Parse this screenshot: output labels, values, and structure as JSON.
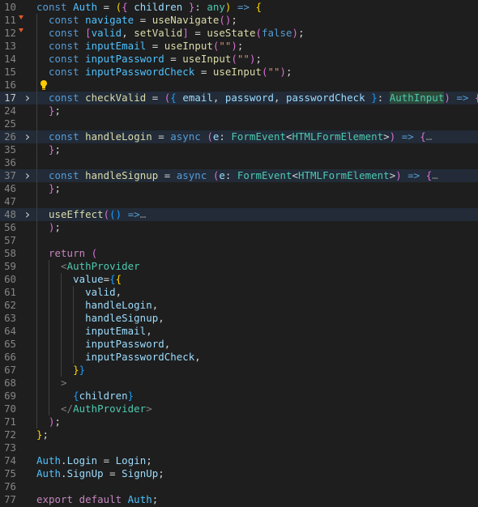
{
  "editor": {
    "lines": [
      {
        "num": "10",
        "code": "<span class='k'>const</span> <span class='cv'>Auth</span> <span class='p'>=</span> <span class='b1'>(</span><span class='b2'>{</span> <span class='v'>children</span> <span class='b2'>}</span><span class='p'>:</span> <span class='t'>any</span><span class='b1'>)</span> <span class='k'>=&gt;</span> <span class='b1'>{</span>"
      },
      {
        "num": "11",
        "mark": true,
        "code": "  <span class='k'>const</span> <span class='cv'>navigate</span> <span class='p'>=</span> <span class='f'>useNavigate</span><span class='b2'>()</span><span class='p'>;</span>"
      },
      {
        "num": "12",
        "mark": true,
        "code": "  <span class='k'>const</span> <span class='b2'>[</span><span class='cv'>valid</span><span class='p'>,</span> <span class='f'>setValid</span><span class='b2'>]</span> <span class='p'>=</span> <span class='f'>useState</span><span class='b2'>(</span><span class='k'>false</span><span class='b2'>)</span><span class='p'>;</span>"
      },
      {
        "num": "13",
        "code": "  <span class='k'>const</span> <span class='cv'>inputEmail</span> <span class='p'>=</span> <span class='f'>useInput</span><span class='b2'>(</span><span class='s'>\"\"</span><span class='b2'>)</span><span class='p'>;</span>"
      },
      {
        "num": "14",
        "code": "  <span class='k'>const</span> <span class='cv'>inputPassword</span> <span class='p'>=</span> <span class='f'>useInput</span><span class='b2'>(</span><span class='s'>\"\"</span><span class='b2'>)</span><span class='p'>;</span>"
      },
      {
        "num": "15",
        "code": "  <span class='k'>const</span> <span class='cv'>inputPasswordCheck</span> <span class='p'>=</span> <span class='f'>useInput</span><span class='b2'>(</span><span class='s'>\"\"</span><span class='b2'>)</span><span class='p'>;</span>"
      },
      {
        "num": "16",
        "bulb": true,
        "code": ""
      },
      {
        "num": "17",
        "active": true,
        "fold": true,
        "hl": true,
        "code": "  <span class='k'>const</span> <span class='f'>checkValid</span> <span class='p'>=</span> <span class='b2'>(</span><span class='b3'>{</span> <span class='v'>email</span><span class='p'>,</span> <span class='v'>password</span><span class='p'>,</span> <span class='v'>passwordCheck</span> <span class='b3'>}</span><span class='p'>:</span> <span class='t sel'>AuthInput</span><span class='b2'>)</span> <span class='k'>=&gt;</span> <span class='b2'>{</span><span class='g'>…</span>"
      },
      {
        "num": "24",
        "code": "  <span class='b2'>}</span><span class='p'>;</span>"
      },
      {
        "num": "25",
        "code": ""
      },
      {
        "num": "26",
        "fold": true,
        "hl": true,
        "code": "  <span class='k'>const</span> <span class='f'>handleLogin</span> <span class='p'>=</span> <span class='k'>async</span> <span class='b2'>(</span><span class='v'>e</span><span class='p'>:</span> <span class='t'>FormEvent</span><span class='p'>&lt;</span><span class='t'>HTMLFormElement</span><span class='p'>&gt;</span><span class='b2'>)</span> <span class='k'>=&gt;</span> <span class='b2'>{</span><span class='g'>…</span>"
      },
      {
        "num": "35",
        "code": "  <span class='b2'>}</span><span class='p'>;</span>"
      },
      {
        "num": "36",
        "code": ""
      },
      {
        "num": "37",
        "fold": true,
        "hl": true,
        "code": "  <span class='k'>const</span> <span class='f'>handleSignup</span> <span class='p'>=</span> <span class='k'>async</span> <span class='b2'>(</span><span class='v'>e</span><span class='p'>:</span> <span class='t'>FormEvent</span><span class='p'>&lt;</span><span class='t'>HTMLFormElement</span><span class='p'>&gt;</span><span class='b2'>)</span> <span class='k'>=&gt;</span> <span class='b2'>{</span><span class='g'>…</span>"
      },
      {
        "num": "46",
        "code": "  <span class='b2'>}</span><span class='p'>;</span>"
      },
      {
        "num": "47",
        "code": ""
      },
      {
        "num": "48",
        "fold": true,
        "hl": true,
        "code": "  <span class='f'>useEffect</span><span class='b2'>(</span><span class='b3'>()</span> <span class='k'>=&gt;</span><span class='g'>…</span>"
      },
      {
        "num": "56",
        "code": "  <span class='b2'>)</span><span class='p'>;</span>"
      },
      {
        "num": "57",
        "code": ""
      },
      {
        "num": "58",
        "code": "  <span class='c'>return</span> <span class='b2'>(</span>"
      },
      {
        "num": "59",
        "code": "    <span class='g'>&lt;</span><span class='t'>AuthProvider</span>"
      },
      {
        "num": "60",
        "code": "      <span class='v'>value</span><span class='p'>=</span><span class='b3'>{</span><span class='b1'>{</span>"
      },
      {
        "num": "61",
        "code": "        <span class='v'>valid</span><span class='p'>,</span>"
      },
      {
        "num": "62",
        "code": "        <span class='v'>handleLogin</span><span class='p'>,</span>"
      },
      {
        "num": "63",
        "code": "        <span class='v'>handleSignup</span><span class='p'>,</span>"
      },
      {
        "num": "64",
        "code": "        <span class='v'>inputEmail</span><span class='p'>,</span>"
      },
      {
        "num": "65",
        "code": "        <span class='v'>inputPassword</span><span class='p'>,</span>"
      },
      {
        "num": "66",
        "code": "        <span class='v'>inputPasswordCheck</span><span class='p'>,</span>"
      },
      {
        "num": "67",
        "code": "      <span class='b1'>}</span><span class='b3'>}</span>"
      },
      {
        "num": "68",
        "code": "    <span class='g'>&gt;</span>"
      },
      {
        "num": "69",
        "code": "      <span class='b3'>{</span><span class='v'>children</span><span class='b3'>}</span>"
      },
      {
        "num": "70",
        "code": "    <span class='g'>&lt;/</span><span class='t'>AuthProvider</span><span class='g'>&gt;</span>"
      },
      {
        "num": "71",
        "code": "  <span class='b2'>)</span><span class='p'>;</span>"
      },
      {
        "num": "72",
        "code": "<span class='b1'>}</span><span class='p'>;</span>"
      },
      {
        "num": "73",
        "code": ""
      },
      {
        "num": "74",
        "code": "<span class='cv'>Auth</span><span class='p'>.</span><span class='v'>Login</span> <span class='p'>=</span> <span class='v'>Login</span><span class='p'>;</span>"
      },
      {
        "num": "75",
        "code": "<span class='cv'>Auth</span><span class='p'>.</span><span class='v'>SignUp</span> <span class='p'>=</span> <span class='v'>SignUp</span><span class='p'>;</span>"
      },
      {
        "num": "76",
        "code": ""
      },
      {
        "num": "77",
        "code": "<span class='c'>export</span> <span class='c'>default</span> <span class='cv'>Auth</span><span class='p'>;</span>"
      }
    ]
  }
}
